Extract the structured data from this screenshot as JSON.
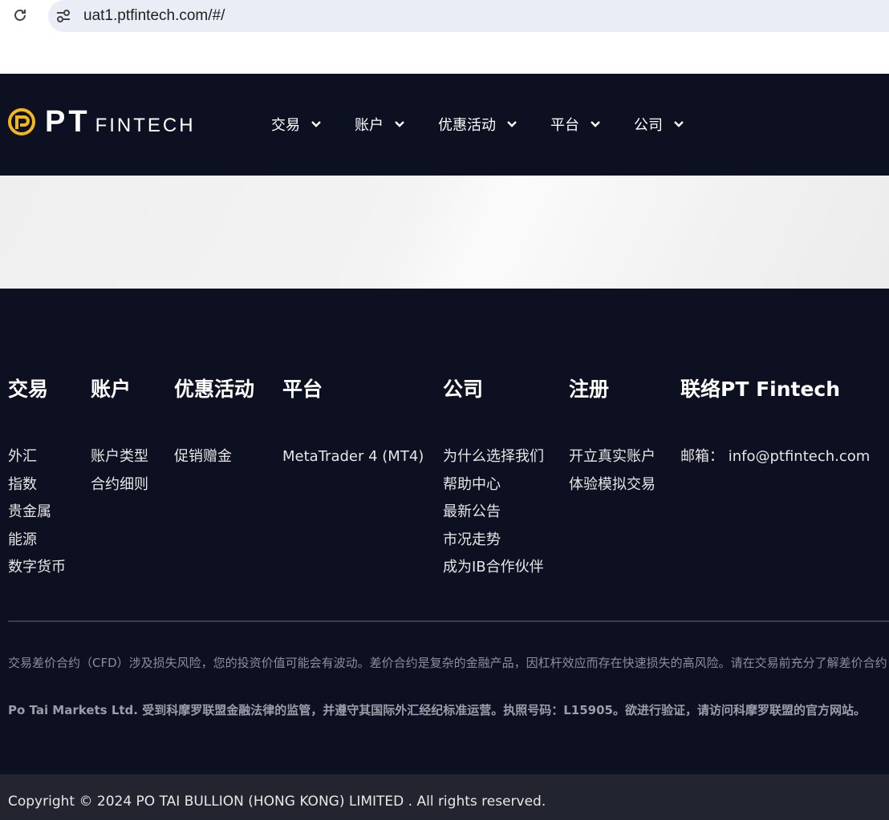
{
  "browser": {
    "url": "uat1.ptfintech.com/#/"
  },
  "colors": {
    "header_bg": "#0c1020",
    "accent_gold": "#f2b718",
    "copyright_bg": "#22252f"
  },
  "header": {
    "logo_pt": "PT",
    "logo_fintech": "FINTECH",
    "nav": [
      {
        "label": "交易"
      },
      {
        "label": "账户"
      },
      {
        "label": "优惠活动"
      },
      {
        "label": "平台"
      },
      {
        "label": "公司"
      }
    ]
  },
  "footer": {
    "columns": [
      {
        "title": "交易",
        "links": [
          "外汇",
          "指数",
          "贵金属",
          "能源",
          "数字货币"
        ]
      },
      {
        "title": "账户",
        "links": [
          "账户类型",
          "合约细则"
        ]
      },
      {
        "title": "优惠活动",
        "links": [
          "促销赠金"
        ]
      },
      {
        "title": "平台",
        "links": [
          "MetaTrader 4 (MT4)"
        ]
      },
      {
        "title": "公司",
        "links": [
          "为什么选择我们",
          "帮助中心",
          "最新公告",
          "市况走势",
          "成为IB合作伙伴"
        ]
      },
      {
        "title": "注册",
        "links": [
          "开立真实账户",
          "体验模拟交易"
        ]
      },
      {
        "title": "联络PT Fintech",
        "links": [
          "邮箱： info@ptfintech.com"
        ]
      }
    ],
    "risk_warning": "交易差价合约（CFD）涉及损失风险，您的投资价值可能会有波动。差价合约是复杂的金融产品，因杠杆效应而存在快速损失的高风险。请在交易前充分了解差价合约",
    "license": "Po Tai Markets Ltd. 受到科摩罗联盟金融法律的监管，并遵守其国际外汇经纪标准运营。执照号码：L15905。欲进行验证，请访问科摩罗联盟的官方网站。",
    "copyright": "Copyright © 2024 PO TAI BULLION (HONG KONG) LIMITED . All rights reserved."
  }
}
